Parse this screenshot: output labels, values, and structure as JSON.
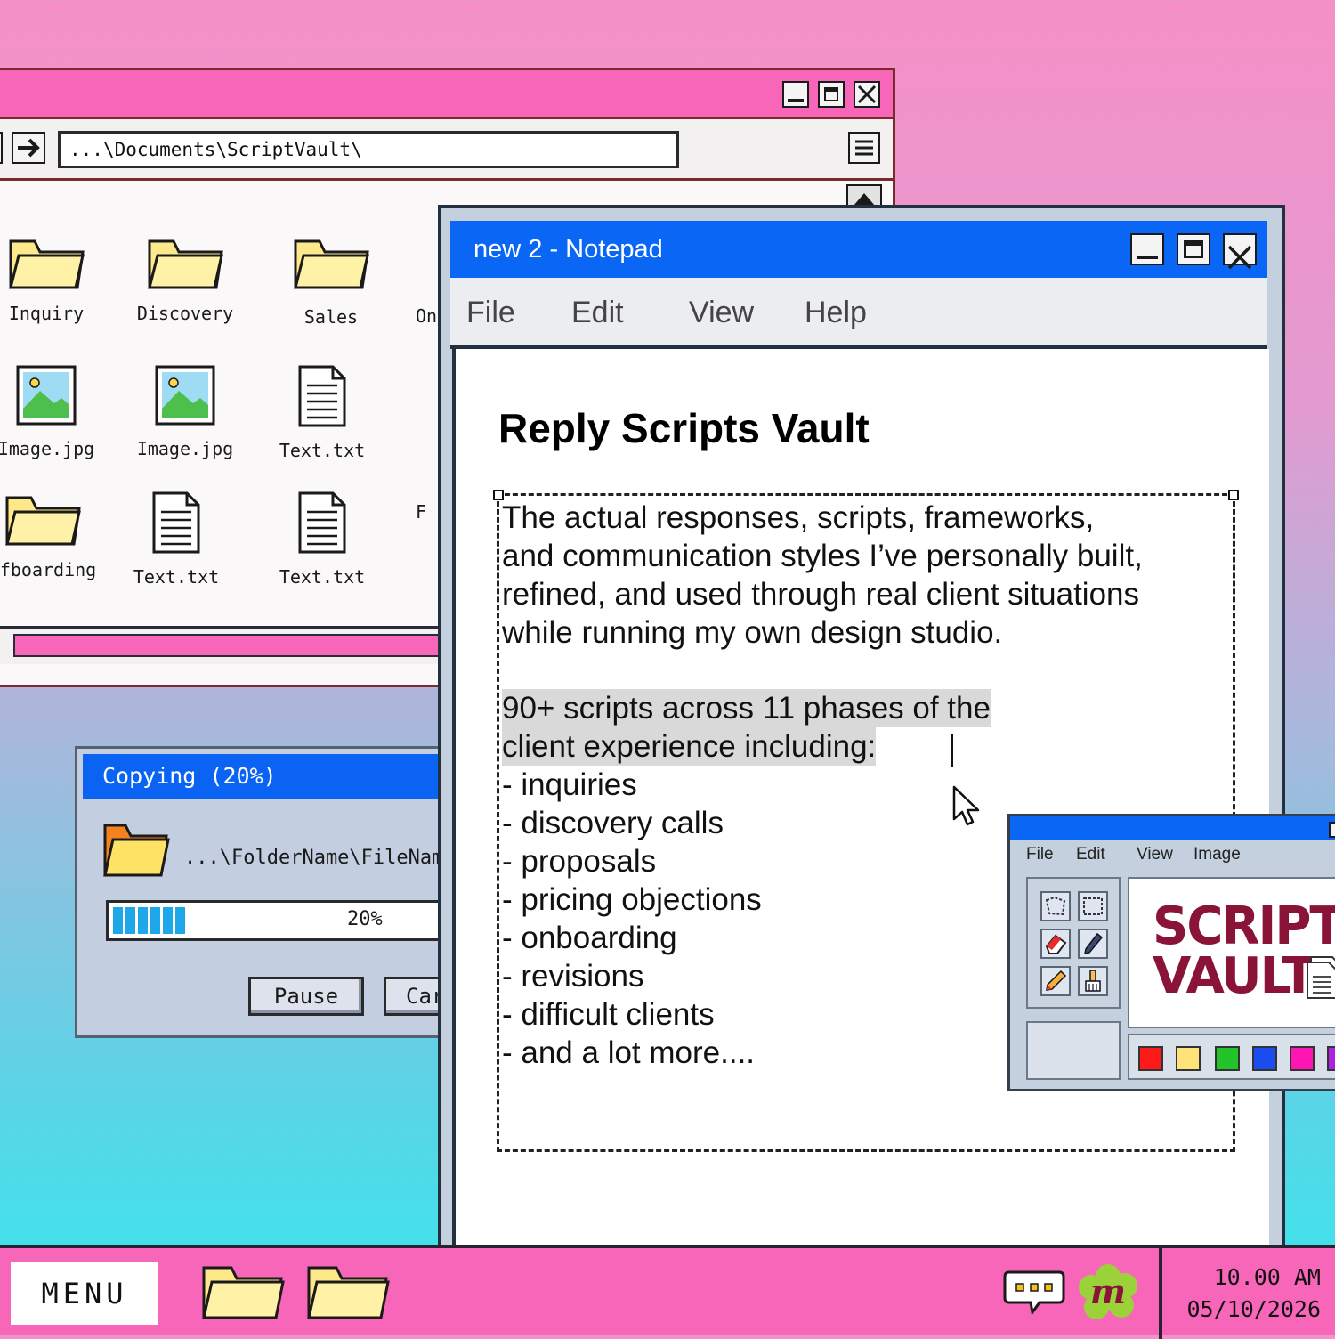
{
  "explorer": {
    "address": "...\\Documents\\ScriptVault\\",
    "items": [
      {
        "label": "Inquiry",
        "icon": "folder-icon"
      },
      {
        "label": "Discovery",
        "icon": "folder-icon"
      },
      {
        "label": "Sales",
        "icon": "folder-icon"
      },
      {
        "label": "On",
        "icon": "folder-icon"
      },
      {
        "label": "Image.jpg",
        "icon": "image-file-icon"
      },
      {
        "label": "Image.jpg",
        "icon": "image-file-icon"
      },
      {
        "label": "Text.txt",
        "icon": "text-file-icon"
      },
      {
        "label": "F",
        "icon": "file-icon"
      },
      {
        "label": "ffboarding",
        "icon": "folder-icon"
      },
      {
        "label": "Text.txt",
        "icon": "text-file-icon"
      },
      {
        "label": "Text.txt",
        "icon": "text-file-icon"
      }
    ]
  },
  "copy_dialog": {
    "title": "Copying (20%)",
    "path": "...\\FolderName\\FileName",
    "progress_text": "20%",
    "progress_value": 0.2,
    "pause_label": "Pause",
    "cancel_label": "Car"
  },
  "notepad": {
    "title": "new 2 - Notepad",
    "menu": [
      "File",
      "Edit",
      "View",
      "Help"
    ],
    "doc_title": "Reply Scripts Vault",
    "paragraph": [
      "The actual responses, scripts, frameworks,",
      "and communication styles I’ve personally built,",
      "refined, and used through real client situations",
      "while running my own design studio."
    ],
    "highlight": [
      "90+ scripts across 11 phases of the",
      "client experience including:"
    ],
    "list": [
      "- inquiries",
      "- discovery calls",
      "- proposals",
      "- pricing objections",
      "- onboarding",
      "- revisions",
      "- difficult clients",
      "- and a lot more...."
    ]
  },
  "paint": {
    "menu": [
      "File",
      "Edit",
      "View",
      "Image"
    ],
    "canvas_line1": "SCRIPTS",
    "canvas_line2": "VAULT",
    "palette": [
      "#ff1a1a",
      "#ffe27a",
      "#22c42a",
      "#1a4cf0",
      "#ff14b4",
      "#b020e0"
    ]
  },
  "taskbar": {
    "menu_label": "MENU",
    "time": "10.00 AM",
    "date": "05/10/2026",
    "logo_letter": "m"
  },
  "colors": {
    "accent_blue": "#0a66f5",
    "pink": "#f766b8",
    "brand_maroon": "#8a1438"
  }
}
